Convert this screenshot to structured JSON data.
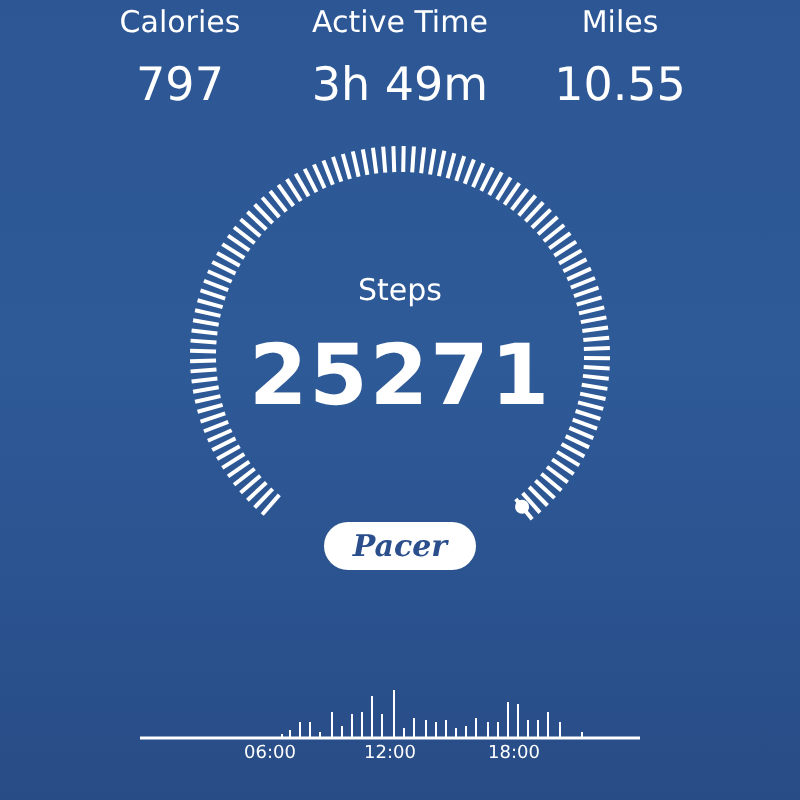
{
  "stats": [
    {
      "label": "Calories",
      "value": "797"
    },
    {
      "label": "Active Time",
      "value": "3h 49m"
    },
    {
      "label": "Miles",
      "value": "10.55"
    }
  ],
  "dial": {
    "label": "Steps",
    "value": "25271"
  },
  "logo": {
    "text": "Pacer"
  },
  "hourly_chart": {
    "kind": "picture",
    "time_labels": [
      "06:00",
      "12:00",
      "18:00"
    ]
  }
}
